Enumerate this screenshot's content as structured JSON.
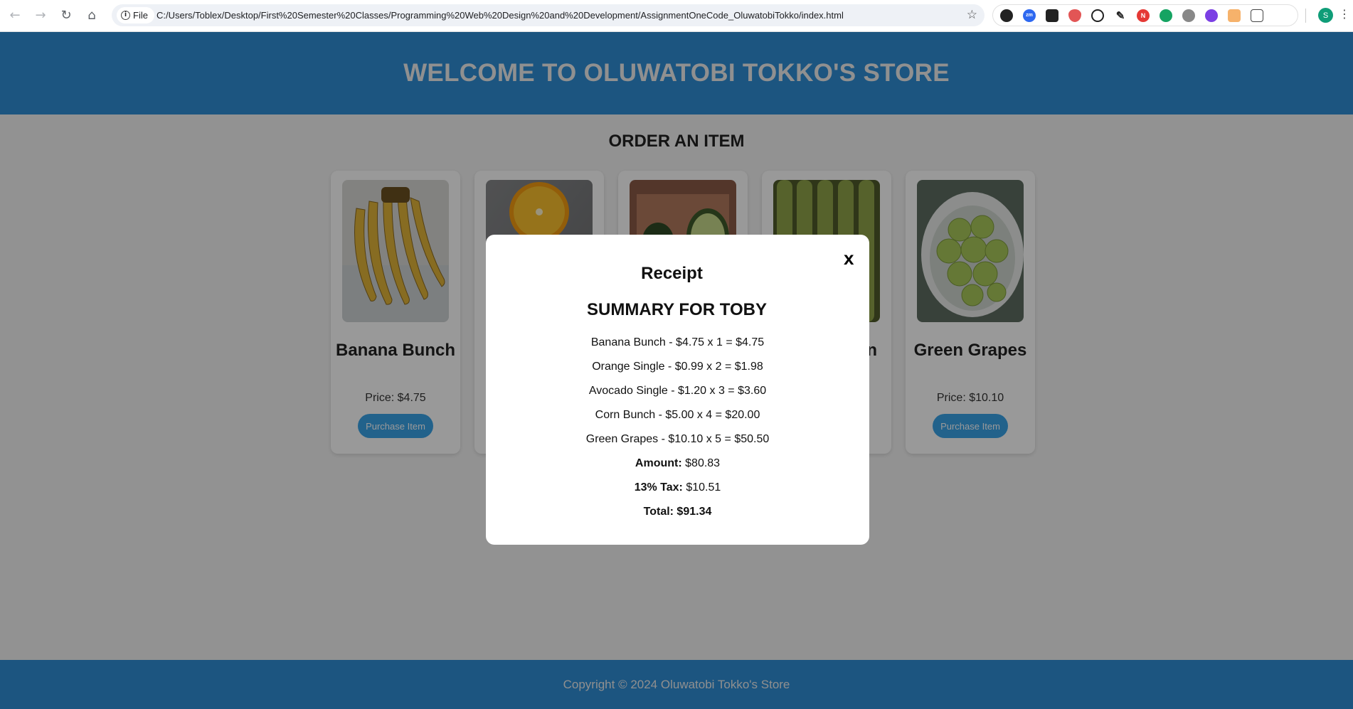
{
  "browser": {
    "site_chip": "File",
    "url": "C:/Users/Toblex/Desktop/First%20Semester%20Classes/Programming%20Web%20Design%20and%20Development/AssignmentOneCode_OluwatobiTokko/index.html",
    "profile_initial": "S",
    "extension_badge_zm": "zm",
    "extension_badge_n": "N"
  },
  "header": {
    "title": "WELCOME TO OLUWATOBI TOKKO'S STORE"
  },
  "section": {
    "title": "ORDER AN ITEM"
  },
  "products": [
    {
      "name": "Banana Bunch",
      "price": "Price: $4.75",
      "button": "Purchase Item",
      "image": "banana"
    },
    {
      "name": "Orange Single",
      "price": "",
      "button": "",
      "image": "orange"
    },
    {
      "name": "Avocado Single",
      "price": "",
      "button": "",
      "image": "avocado"
    },
    {
      "name": "n",
      "price": "",
      "button": "",
      "image": "corn"
    },
    {
      "name": "Green Grapes",
      "price": "Price: $10.10",
      "button": "Purchase Item",
      "image": "grapes"
    }
  ],
  "receipt": {
    "close": "x",
    "title": "Receipt",
    "summary_title": "SUMMARY FOR TOBY",
    "items": [
      "Banana Bunch - $4.75 x 1 = $4.75",
      "Orange Single - $0.99 x 2 = $1.98",
      "Avocado Single - $1.20 x 3 = $3.60",
      "Corn Bunch - $5.00 x 4 = $20.00",
      "Green Grapes - $10.10 x 5 = $50.50"
    ],
    "amount_label": "Amount:",
    "amount_value": "$80.83",
    "tax_label": "13% Tax:",
    "tax_value": "$10.51",
    "total": "Total: $91.34"
  },
  "footer": {
    "copyright": "Copyright © 2024 Oluwatobi Tokko's Store"
  },
  "colors": {
    "brand_blue": "#2f8ed6",
    "button_blue": "#3aa3e8",
    "overlay": "rgba(0,0,0,0.4)"
  }
}
